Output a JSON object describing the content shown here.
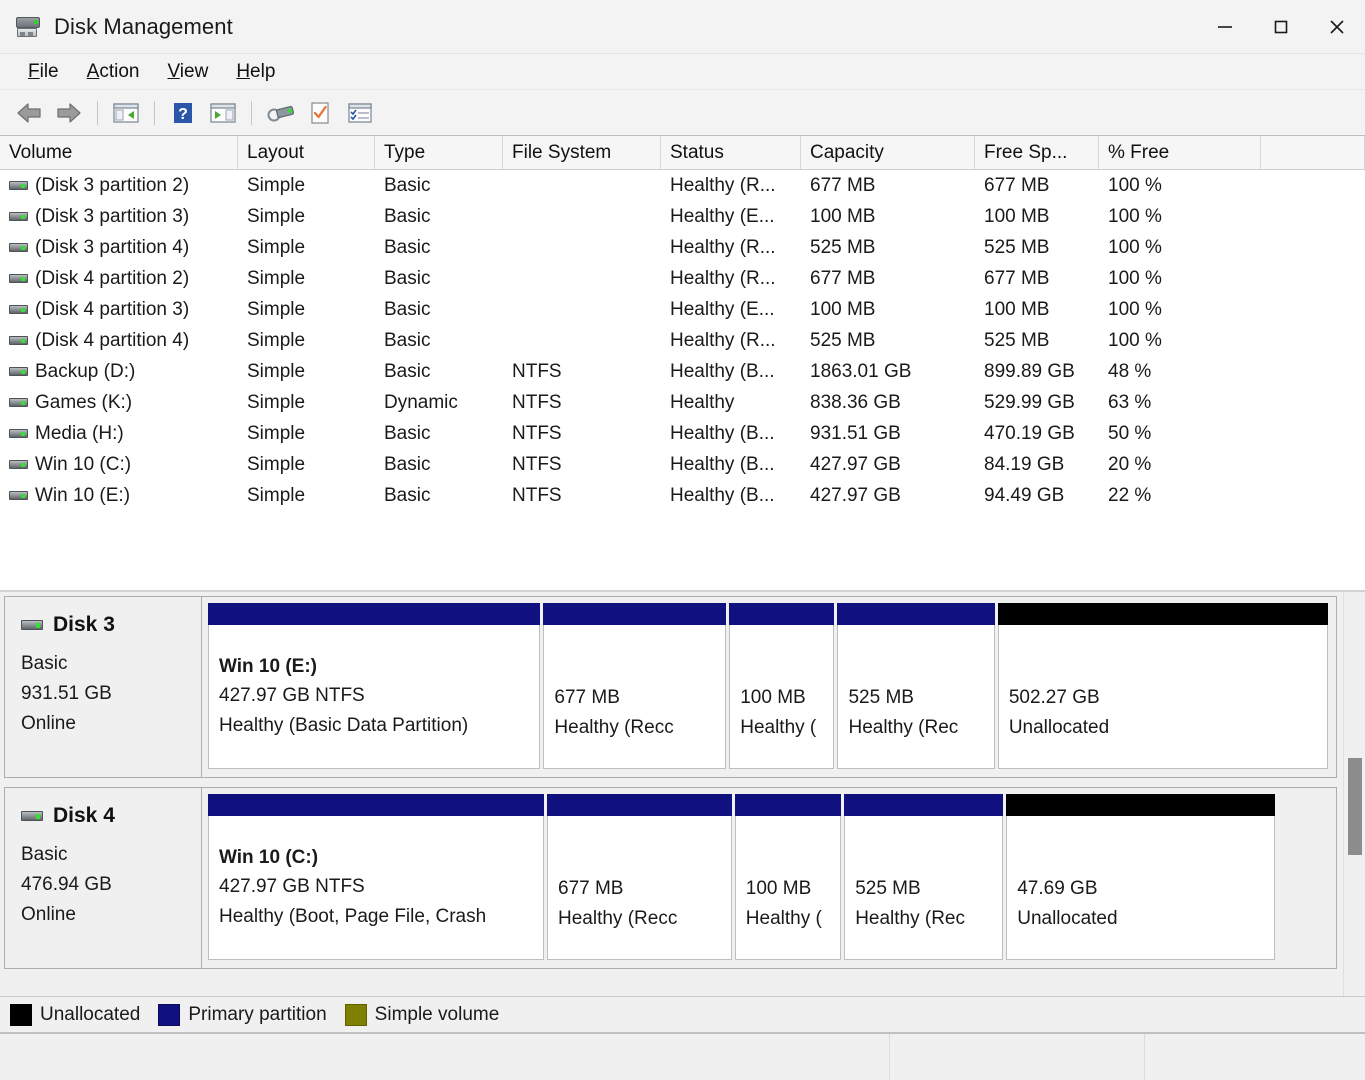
{
  "window": {
    "title": "Disk Management",
    "icon": "disk-management-icon",
    "controls": {
      "minimize": "minimize-icon",
      "maximize": "maximize-icon",
      "close": "close-icon"
    }
  },
  "menubar": {
    "items": [
      {
        "label": "File",
        "mnemonic": "F"
      },
      {
        "label": "Action",
        "mnemonic": "A"
      },
      {
        "label": "View",
        "mnemonic": "V"
      },
      {
        "label": "Help",
        "mnemonic": "H"
      }
    ]
  },
  "toolbar": {
    "buttons": [
      {
        "icon": "back-arrow-icon"
      },
      {
        "icon": "forward-arrow-icon"
      },
      {
        "icon": "show-hide-console-tree-icon"
      },
      {
        "icon": "help-icon"
      },
      {
        "icon": "show-hide-action-pane-icon"
      },
      {
        "icon": "rescan-disks-icon"
      },
      {
        "icon": "properties-icon"
      },
      {
        "icon": "help-topics-icon"
      }
    ]
  },
  "volume_list": {
    "columns": [
      "Volume",
      "Layout",
      "Type",
      "File System",
      "Status",
      "Capacity",
      "Free Sp...",
      "% Free"
    ],
    "rows": [
      {
        "volume": "(Disk 3 partition 2)",
        "layout": "Simple",
        "type": "Basic",
        "filesystem": "",
        "status": "Healthy (R...",
        "capacity": "677 MB",
        "free": "677 MB",
        "pct": "100 %"
      },
      {
        "volume": "(Disk 3 partition 3)",
        "layout": "Simple",
        "type": "Basic",
        "filesystem": "",
        "status": "Healthy (E...",
        "capacity": "100 MB",
        "free": "100 MB",
        "pct": "100 %"
      },
      {
        "volume": "(Disk 3 partition 4)",
        "layout": "Simple",
        "type": "Basic",
        "filesystem": "",
        "status": "Healthy (R...",
        "capacity": "525 MB",
        "free": "525 MB",
        "pct": "100 %"
      },
      {
        "volume": "(Disk 4 partition 2)",
        "layout": "Simple",
        "type": "Basic",
        "filesystem": "",
        "status": "Healthy (R...",
        "capacity": "677 MB",
        "free": "677 MB",
        "pct": "100 %"
      },
      {
        "volume": "(Disk 4 partition 3)",
        "layout": "Simple",
        "type": "Basic",
        "filesystem": "",
        "status": "Healthy (E...",
        "capacity": "100 MB",
        "free": "100 MB",
        "pct": "100 %"
      },
      {
        "volume": "(Disk 4 partition 4)",
        "layout": "Simple",
        "type": "Basic",
        "filesystem": "",
        "status": "Healthy (R...",
        "capacity": "525 MB",
        "free": "525 MB",
        "pct": "100 %"
      },
      {
        "volume": "Backup (D:)",
        "layout": "Simple",
        "type": "Basic",
        "filesystem": "NTFS",
        "status": "Healthy (B...",
        "capacity": "1863.01 GB",
        "free": "899.89 GB",
        "pct": "48 %"
      },
      {
        "volume": "Games (K:)",
        "layout": "Simple",
        "type": "Dynamic",
        "filesystem": "NTFS",
        "status": "Healthy",
        "capacity": "838.36 GB",
        "free": "529.99 GB",
        "pct": "63 %"
      },
      {
        "volume": "Media (H:)",
        "layout": "Simple",
        "type": "Basic",
        "filesystem": "NTFS",
        "status": "Healthy (B...",
        "capacity": "931.51 GB",
        "free": "470.19 GB",
        "pct": "50 %"
      },
      {
        "volume": "Win 10 (C:)",
        "layout": "Simple",
        "type": "Basic",
        "filesystem": "NTFS",
        "status": "Healthy (B...",
        "capacity": "427.97 GB",
        "free": "84.19 GB",
        "pct": "20 %"
      },
      {
        "volume": "Win 10 (E:)",
        "layout": "Simple",
        "type": "Basic",
        "filesystem": "NTFS",
        "status": "Healthy (B...",
        "capacity": "427.97 GB",
        "free": "94.49 GB",
        "pct": "22 %"
      }
    ]
  },
  "graphical_view": {
    "disks": [
      {
        "name": "Disk 3",
        "disk_type": "Basic",
        "size": "931.51 GB",
        "state": "Online",
        "partitions": [
          {
            "label": "Win 10  (E:)",
            "size": "427.97 GB NTFS",
            "status": "Healthy (Basic Data Partition)",
            "bar_color": "#10107e",
            "width_pct": 30.0
          },
          {
            "label": "",
            "size": "677 MB",
            "status": "Healthy (Recc",
            "bar_color": "#10107e",
            "width_pct": 16.5
          },
          {
            "label": "",
            "size": "100 MB",
            "status": "Healthy (",
            "bar_color": "#10107e",
            "width_pct": 9.5
          },
          {
            "label": "",
            "size": "525 MB",
            "status": "Healthy (Rec",
            "bar_color": "#10107e",
            "width_pct": 14.2
          },
          {
            "label": "",
            "size": "502.27 GB",
            "status": "Unallocated",
            "bar_color": "#000000",
            "width_pct": 29.8
          }
        ]
      },
      {
        "name": "Disk 4",
        "disk_type": "Basic",
        "size": "476.94 GB",
        "state": "Online",
        "partitions": [
          {
            "label": "Win 10  (C:)",
            "size": "427.97 GB NTFS",
            "status": "Healthy (Boot, Page File, Crash",
            "bar_color": "#10107e",
            "width_pct": 30.0
          },
          {
            "label": "",
            "size": "677 MB",
            "status": "Healthy (Recc",
            "bar_color": "#10107e",
            "width_pct": 16.5
          },
          {
            "label": "",
            "size": "100 MB",
            "status": "Healthy (",
            "bar_color": "#10107e",
            "width_pct": 9.5
          },
          {
            "label": "",
            "size": "525 MB",
            "status": "Healthy (Rec",
            "bar_color": "#10107e",
            "width_pct": 14.2
          },
          {
            "label": "",
            "size": "47.69 GB",
            "status": "Unallocated",
            "bar_color": "#000000",
            "width_pct": 24.0
          }
        ]
      }
    ],
    "scrollbar": {
      "thumb_top_pct": 41,
      "thumb_height_pct": 24
    }
  },
  "legend": {
    "items": [
      {
        "label": "Unallocated",
        "color": "#000000"
      },
      {
        "label": "Primary partition",
        "color": "#10107e"
      },
      {
        "label": "Simple volume",
        "color": "#808000"
      }
    ]
  },
  "statusbar": {
    "segments": [
      "",
      "",
      ""
    ]
  },
  "colors": {
    "primary_partition": "#10107e",
    "unallocated": "#000000",
    "simple_volume": "#808000",
    "window_bg": "#f0f0f0",
    "list_bg": "#ffffff"
  }
}
